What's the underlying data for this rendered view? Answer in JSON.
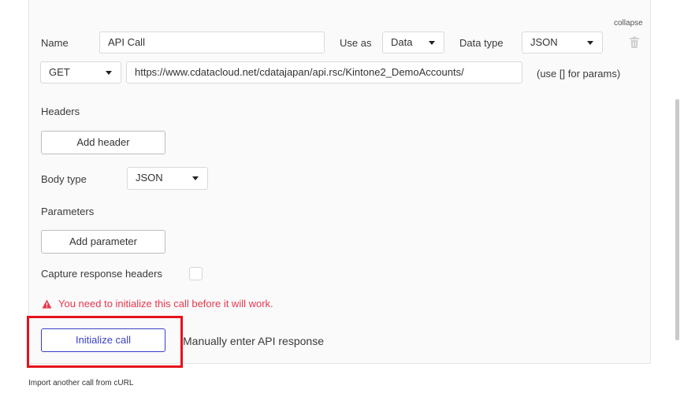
{
  "colors": {
    "accent": "#3a3fc4",
    "warning": "#e8384f",
    "highlight": "#e5121b"
  },
  "call": {
    "collapse_label": "collapse",
    "name_label": "Name",
    "name_value": "API Call",
    "use_as_label": "Use as",
    "use_as_value": "Data",
    "data_type_label": "Data type",
    "data_type_value": "JSON",
    "delete_icon": "trash-icon",
    "method_value": "GET",
    "url_value": "https://www.cdatacloud.net/cdatajapan/api.rsc/Kintone2_DemoAccounts/",
    "params_hint": "(use [] for params)",
    "headers_label": "Headers",
    "add_header_label": "Add header",
    "body_type_label": "Body type",
    "body_type_value": "JSON",
    "parameters_label": "Parameters",
    "add_parameter_label": "Add parameter",
    "capture_headers_label": "Capture response headers",
    "warning_icon": "warning-triangle-icon",
    "warning_text": "You need to initialize this call before it will work.",
    "initialize_label": "Initialize call",
    "manual_label": "Manually enter API response"
  },
  "footer": {
    "import_label": "Import another call from cURL"
  }
}
